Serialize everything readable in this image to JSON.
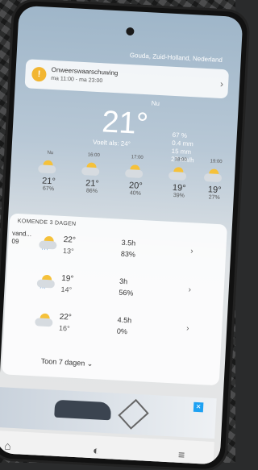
{
  "location": "Gouda, Zuid-Holland, Nederland",
  "warning": {
    "title": "Onweerswaarschuwing",
    "time": "ma 11:00 - ma 23:00"
  },
  "current": {
    "label": "Nu",
    "temp": "21°",
    "feels_like": "Voelt als: 24°",
    "stats": [
      "67 %",
      "0.4 mm",
      "15 mm",
      "27 km/h"
    ]
  },
  "hourly": [
    {
      "time": "Nu",
      "temp": "21°",
      "precip": "67%"
    },
    {
      "time": "16:00",
      "temp": "21°",
      "precip": "86%"
    },
    {
      "time": "17:00",
      "temp": "20°",
      "precip": "40%"
    },
    {
      "time": "18:00",
      "temp": "19°",
      "precip": "39%"
    },
    {
      "time": "19:00",
      "temp": "19°",
      "precip": "27%"
    }
  ],
  "forecast": {
    "title": "KOMENDE 3 DAGEN",
    "days": [
      {
        "label": "vand...",
        "date": "09",
        "hi": "22°",
        "lo": "13°",
        "sun": "3.5h",
        "precip": "83%"
      },
      {
        "label": "",
        "date": "",
        "hi": "19°",
        "lo": "14°",
        "sun": "3h",
        "precip": "56%"
      },
      {
        "label": "",
        "date": "",
        "hi": "22°",
        "lo": "16°",
        "sun": "4.5h",
        "precip": "0%"
      }
    ],
    "more_label": "Toon 7 dagen"
  },
  "nav": {
    "items": [
      "house-icon",
      "radar-icon",
      "menu-icon"
    ]
  }
}
